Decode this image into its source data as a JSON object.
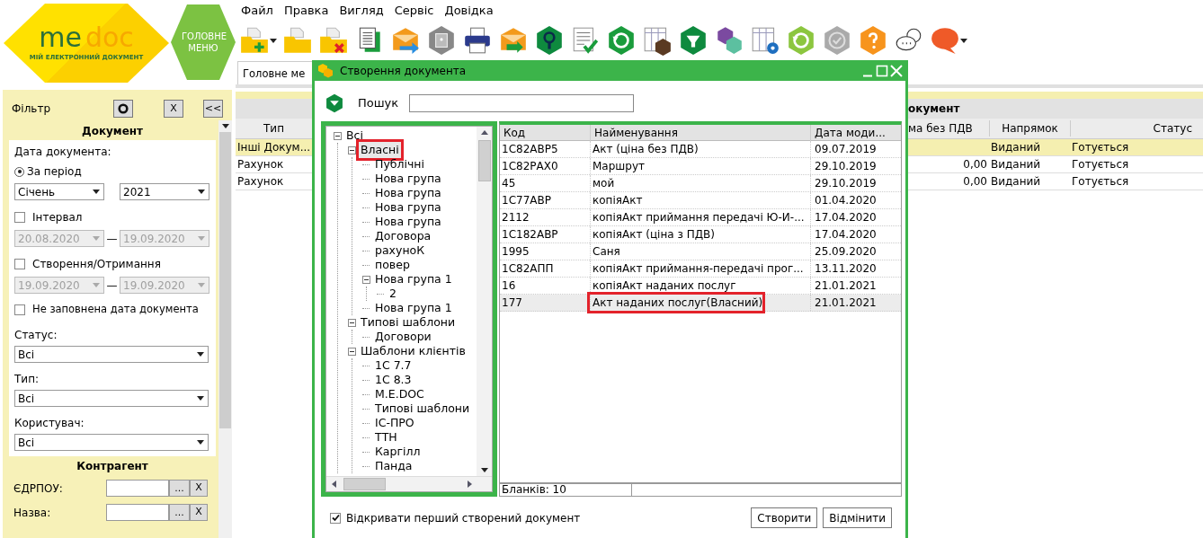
{
  "logo": {
    "word_1": "me",
    "word_2": "doc",
    "tagline": "МІЙ ЕЛЕКТРОННИЙ ДОКУМЕНТ"
  },
  "main_menu_button": "ГОЛОВНЕ МЕНЮ",
  "menu": [
    "Файл",
    "Правка",
    "Вигляд",
    "Сервіс",
    "Довідка"
  ],
  "tabs": [
    {
      "label": "Головне ме",
      "selected": true
    }
  ],
  "filter": {
    "title": "Фільтр",
    "clear_button": "X",
    "collapse_button": "<<",
    "document_section": {
      "heading": "Документ",
      "date_label": "Дата документа:",
      "period": {
        "label": "За період",
        "selected": true,
        "month": "Січень",
        "year": "2021"
      },
      "ranges": [
        {
          "label": "Інтервал",
          "checked": false,
          "disabled": true,
          "from": "20.08.2020",
          "separator": "—",
          "to": "19.09.2020"
        },
        {
          "label": "Створення/Отримання",
          "checked": false,
          "disabled": true,
          "from": "19.09.2020",
          "separator": "—",
          "to": "19.09.2020"
        }
      ],
      "empty_date": {
        "label": "Не заповнена дата документа",
        "checked": false
      },
      "selects": [
        {
          "label": "Статус:",
          "value": "Всі"
        },
        {
          "label": "Тип:",
          "value": "Всі"
        },
        {
          "label": "Користувач:",
          "value": "Всі"
        }
      ]
    },
    "counterparty_section": {
      "heading": "Контрагент",
      "fields": [
        {
          "label": "ЄДРПОУ:",
          "browse": "...",
          "clear": "X"
        },
        {
          "label": "Назва:",
          "browse": "...",
          "clear": "X"
        }
      ]
    }
  },
  "documents_table": {
    "heading": "окумент",
    "columns": [
      "Тип",
      "ма без ПДВ",
      "Напрямок",
      "Статус"
    ],
    "rows": [
      {
        "type": "Інші Докум...",
        "direction": "Виданий",
        "status": "Готується",
        "selected": true
      },
      {
        "type": "Рахунок",
        "sum": "0,00",
        "direction": "Виданий",
        "status": "Готується",
        "selected": false
      },
      {
        "type": "Рахунок",
        "sum": "0,00",
        "direction": "Виданий",
        "status": "Готується",
        "selected": false
      }
    ]
  },
  "dialog": {
    "title": "Створення документа",
    "search_label": "Пошук",
    "tree": [
      {
        "label": "Всі",
        "expanded": true,
        "selected": false,
        "marked": false,
        "children": [
          {
            "label": "Власні",
            "expanded": true,
            "selected": true,
            "marked": true,
            "children": [
              {
                "label": "Публічні",
                "selected": false,
                "marked": false
              },
              {
                "label": "Нова група",
                "selected": false,
                "marked": false
              },
              {
                "label": "Нова група",
                "selected": false,
                "marked": false
              },
              {
                "label": "Нова група",
                "selected": false,
                "marked": false
              },
              {
                "label": "Нова група",
                "selected": false,
                "marked": false
              },
              {
                "label": "Договора",
                "selected": false,
                "marked": false
              },
              {
                "label": "рахуноК",
                "selected": false,
                "marked": false
              },
              {
                "label": "повер",
                "selected": false,
                "marked": false
              },
              {
                "label": "Нова група 1",
                "expanded": true,
                "selected": false,
                "marked": false,
                "children": [
                  {
                    "label": "2",
                    "selected": false,
                    "marked": false
                  }
                ]
              },
              {
                "label": "Нова група 1",
                "selected": false,
                "marked": false
              }
            ]
          },
          {
            "label": "Типові шаблони",
            "expanded": true,
            "selected": false,
            "marked": false,
            "children": [
              {
                "label": "Договори",
                "selected": false,
                "marked": false
              }
            ]
          },
          {
            "label": "Шаблони клієнтів",
            "expanded": true,
            "selected": false,
            "marked": false,
            "children": [
              {
                "label": "1С 7.7",
                "selected": false,
                "marked": false
              },
              {
                "label": "1С 8.3",
                "selected": false,
                "marked": false
              },
              {
                "label": "M.E.DOC",
                "selected": false,
                "marked": false
              },
              {
                "label": "Типові шаблони",
                "selected": false,
                "marked": false
              },
              {
                "label": "ІС-ПРО",
                "selected": false,
                "marked": false
              },
              {
                "label": "ТТН",
                "selected": false,
                "marked": false
              },
              {
                "label": "Каргілл",
                "selected": false,
                "marked": false
              },
              {
                "label": "Панда",
                "selected": false,
                "marked": false
              }
            ]
          }
        ]
      }
    ],
    "columns": [
      "Код",
      "Найменування",
      "Дата моди..."
    ],
    "rows": [
      {
        "code": "1С82АВР5",
        "name": "Акт (ціна без ПДВ)",
        "date": "09.07.2019",
        "selected": false,
        "marked": false
      },
      {
        "code": "1С82РАХ0",
        "name": "Маршрут",
        "date": "29.10.2019",
        "selected": false,
        "marked": false
      },
      {
        "code": "45",
        "name": "мой",
        "date": "29.10.2019",
        "selected": false,
        "marked": false
      },
      {
        "code": "1С77АВР",
        "name": "копіяАкт",
        "date": "01.04.2020",
        "selected": false,
        "marked": false
      },
      {
        "code": "2112",
        "name": "копіяАкт приймання передачі Ю-И-...",
        "date": "17.04.2020",
        "selected": false,
        "marked": false
      },
      {
        "code": "1С182АВР",
        "name": "копіяАкт (ціна з ПДВ)",
        "date": "17.04.2020",
        "selected": false,
        "marked": false
      },
      {
        "code": "1995",
        "name": "Саня",
        "date": "25.09.2020",
        "selected": false,
        "marked": false
      },
      {
        "code": "1С82АПП",
        "name": "копіяАкт приймання-передачі прог...",
        "date": "13.11.2020",
        "selected": false,
        "marked": false
      },
      {
        "code": "16",
        "name": "копіяАкт наданих послуг",
        "date": "21.01.2021",
        "selected": false,
        "marked": false
      },
      {
        "code": "177",
        "name": "Акт наданих послуг(Власний)",
        "date": "21.01.2021",
        "selected": true,
        "marked": true
      }
    ],
    "count": "Бланків: 10",
    "open_first": {
      "label": "Відкривати перший створений документ",
      "checked": true
    },
    "buttons": [
      "Створити",
      "Відмінити"
    ]
  }
}
